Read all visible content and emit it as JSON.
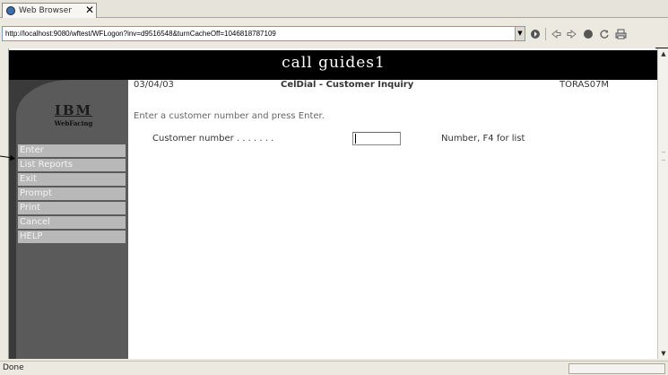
{
  "browser": {
    "tab_label": "Web Browser",
    "close_glyph": "✕",
    "url": "http://localhost:9080/wftest/WFLogon?inv=d9516548&turnCacheOff=1046818787109",
    "dropdown_glyph": "▼",
    "nav_icons": [
      "go-icon",
      "back-icon",
      "forward-icon",
      "stop-icon",
      "refresh-icon",
      "print-icon"
    ],
    "status": "Done"
  },
  "page": {
    "banner_title": "call guides1",
    "logo": {
      "brand": "IBM",
      "product": "WebFacing"
    },
    "menu": [
      "Enter",
      "List Reports",
      "Exit",
      "Prompt",
      "Print",
      "Cancel",
      "HELP"
    ],
    "header": {
      "date": "03/04/03",
      "title": "CelDial - Customer Inquiry",
      "system_id": "TORAS07M"
    },
    "instruction": "Enter a customer number and press Enter.",
    "field": {
      "label": "Customer number . . . . . . .",
      "value": "",
      "hint": "Number, F4 for list"
    }
  },
  "colors": {
    "banner": "#000000",
    "sidebar": "#5a5a5a",
    "menu_item": "#b8b8b8"
  }
}
